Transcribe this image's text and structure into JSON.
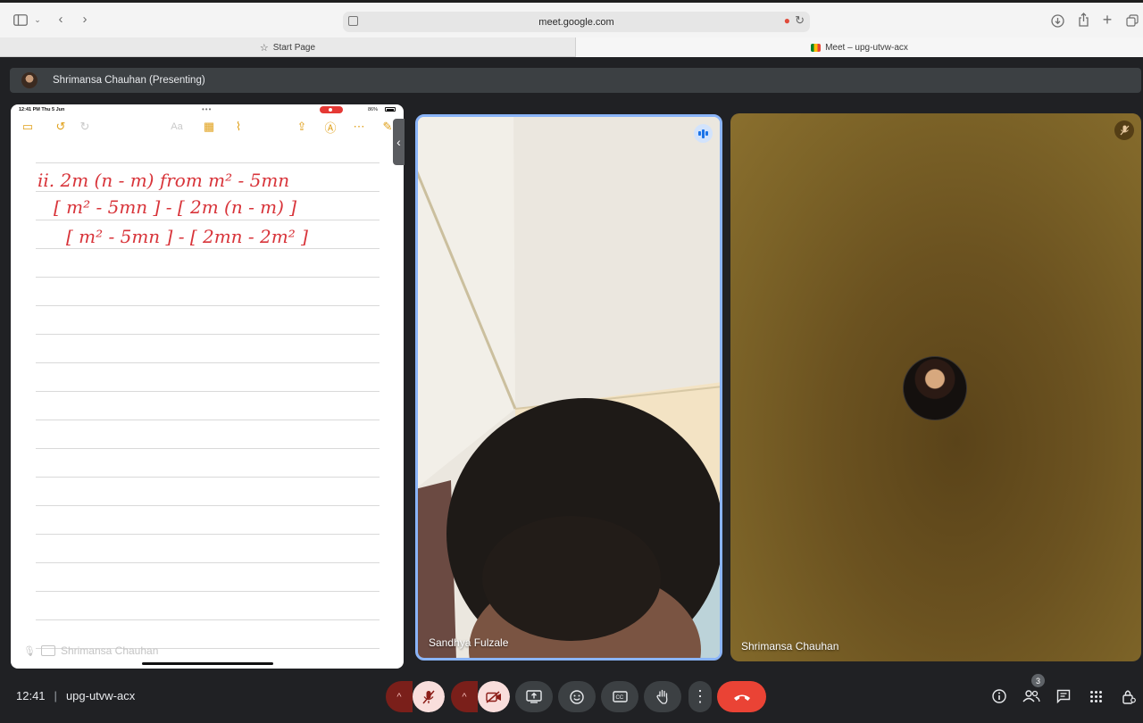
{
  "browser": {
    "url": "meet.google.com",
    "tabs": [
      {
        "label": "Start Page",
        "icon": "star-icon"
      },
      {
        "label": "Meet – upg-utvw-acx",
        "icon": "google-meet-favicon"
      }
    ]
  },
  "presentation": {
    "presenter_label": "Shrimansa Chauhan (Presenting)"
  },
  "shared_screen": {
    "status_time": "12:41 PM  Thu 5 Jun",
    "battery": "86%",
    "handwritten_lines": [
      "ii.  2m (n - m)  from  m² - 5mn",
      "[ m² - 5mn ] - [ 2m (n - m) ]",
      "[ m² - 5mn ] - [ 2mn - 2m² ]"
    ],
    "footer_name": "Shrimansa Chauhan"
  },
  "participants": [
    {
      "name": "Sandhya Fulzale",
      "state": "speaking"
    },
    {
      "name": "Shrimansa Chauhan",
      "state": "muted"
    }
  ],
  "meeting": {
    "time": "12:41",
    "code": "upg-utvw-acx",
    "participant_count": "3"
  },
  "colors": {
    "mic_off": "#f9dedc",
    "end_call": "#ea4335",
    "speaking_border": "#8ab4f8"
  }
}
